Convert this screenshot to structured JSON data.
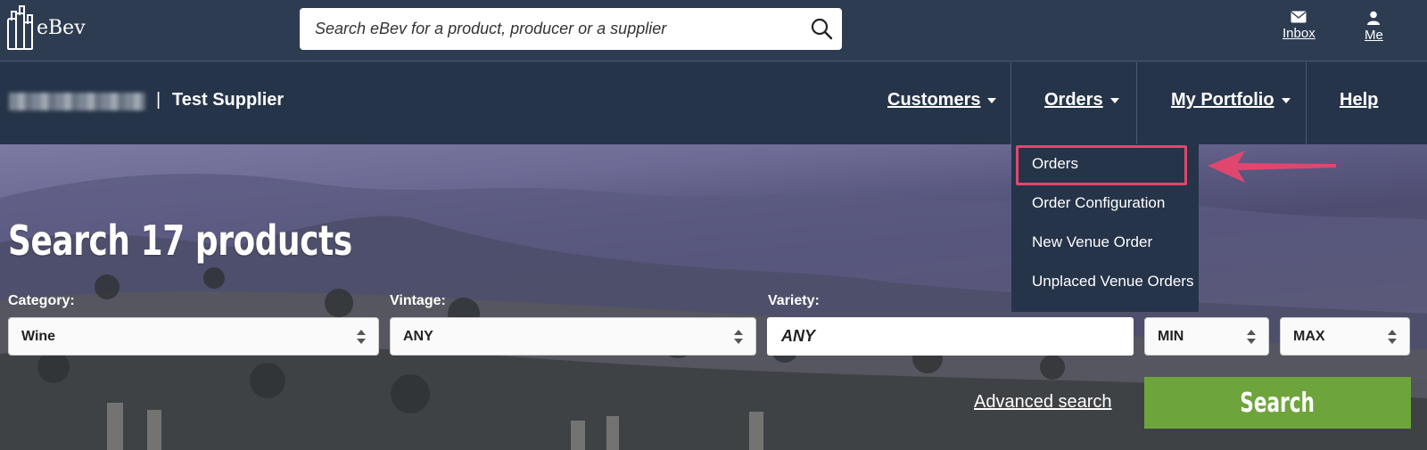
{
  "header": {
    "logo_text": "eBev",
    "search_placeholder": "Search eBev for a product, producer or a supplier",
    "inbox_label": "Inbox",
    "me_label": "Me"
  },
  "nav": {
    "separator": "|",
    "supplier_name": "Test Supplier",
    "items": [
      {
        "label": "Customers"
      },
      {
        "label": "Orders"
      },
      {
        "label": "My Portfolio"
      },
      {
        "label": "Help"
      }
    ]
  },
  "orders_dropdown": {
    "items": [
      "Orders",
      "Order Configuration",
      "New Venue Order",
      "Unplaced Venue Orders"
    ],
    "highlight_color": "#e0476e"
  },
  "hero": {
    "title": "Search 17 products",
    "category_label": "Category:",
    "category_value": "Wine",
    "vintage_label": "Vintage:",
    "vintage_value": "ANY",
    "variety_label": "Variety:",
    "variety_value": "ANY",
    "min_value": "MIN",
    "max_value": "MAX",
    "advanced_search": "Advanced search",
    "search_button": "Search",
    "search_button_color": "#6ea43c"
  }
}
